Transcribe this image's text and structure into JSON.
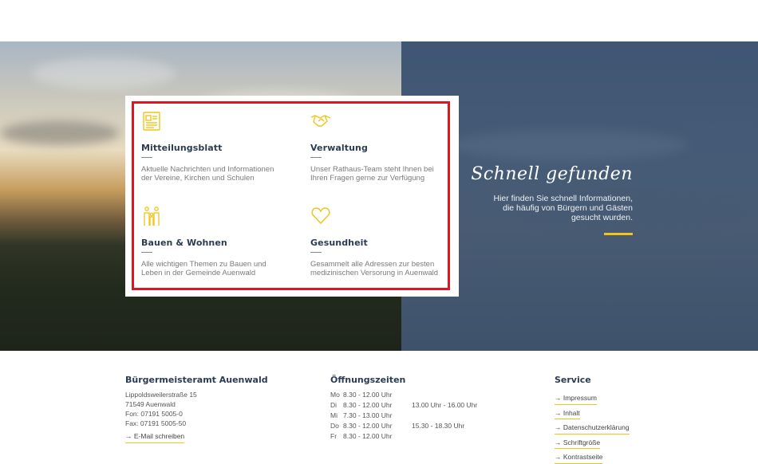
{
  "tiles": [
    {
      "icon": "newspaper-icon",
      "title": "Mitteilungsblatt",
      "text": "Aktuelle Nachrichten und Informationen der Vereine, Kirchen und Schulen"
    },
    {
      "icon": "handshake-icon",
      "title": "Verwaltung",
      "text": "Unser Rathaus-Team steht Ihnen bei Ihren Fragen gerne zur Verfügung"
    },
    {
      "icon": "family-icon",
      "title": "Bauen & Wohnen",
      "text": "Alle wichtigen Themen zu Bauen und Leben in der Gemeinde Auenwald"
    },
    {
      "icon": "heart-icon",
      "title": "Gesundheit",
      "text": "Gesammelt alle Adressen zur besten medizinischen Versorung in Auenwald"
    }
  ],
  "quickfind": {
    "title": "Schnell gefunden",
    "line1": "Hier finden Sie schnell Informationen,",
    "line2": "die häufig von Bürgern und Gästen",
    "line3": "gesucht wurden."
  },
  "footer": {
    "address": {
      "title": "Bürgermeisteramt Auenwald",
      "street": "Lippoldsweilerstraße 15",
      "city": "71549 Auenwald",
      "phone": "Fon: 07191 5005-0",
      "fax": "Fax: 07191 5005-50",
      "email_link": "→ E-Mail schreiben"
    },
    "hours": {
      "title": "Öffnungszeiten",
      "rows": [
        {
          "day": "Mo",
          "am": "8.30 - 12.00 Uhr",
          "pm": ""
        },
        {
          "day": "Di",
          "am": "8.30 - 12.00 Uhr",
          "pm": "13.00 Uhr - 16.00 Uhr"
        },
        {
          "day": "Mi",
          "am": "7.30 - 13.00 Uhr",
          "pm": ""
        },
        {
          "day": "Do",
          "am": "8.30 - 12.00 Uhr",
          "pm": "15.30 - 18.30 Uhr"
        },
        {
          "day": "Fr",
          "am": "8.30 - 12.00 Uhr",
          "pm": ""
        }
      ]
    },
    "service": {
      "title": "Service",
      "links": [
        "→ Impressum",
        "→ Inhalt",
        "→ Datenschutzerklärung",
        "→ Schriftgröße",
        "→ Kontrastseite"
      ]
    }
  },
  "colors": {
    "accent": "#f0c419",
    "navy": "#2b3c52",
    "highlight": "#e3141d",
    "panel": "#465b76"
  }
}
